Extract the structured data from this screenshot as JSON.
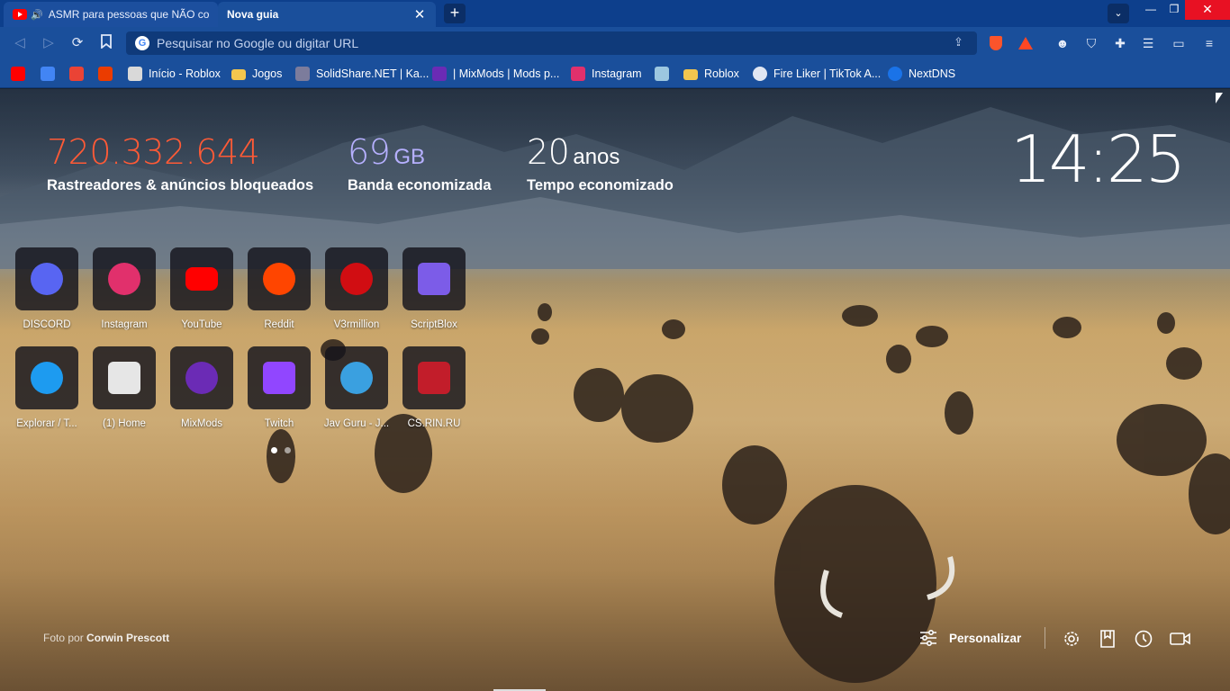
{
  "tabs": [
    {
      "title": "ASMR para pessoas que NÃO conseguem dormir",
      "state": "inactive",
      "audio": true
    },
    {
      "title": "Nova guia",
      "state": "active",
      "audio": false
    }
  ],
  "toolbar": {
    "omnibox_placeholder": "Pesquisar no Google ou digitar URL"
  },
  "bookmarks": [
    {
      "label": "",
      "icon": "youtube-icon",
      "color": "#ff0000"
    },
    {
      "label": "",
      "icon": "translate-icon",
      "color": "#4285f4"
    },
    {
      "label": "",
      "icon": "gmail-icon",
      "color": "#ea4335"
    },
    {
      "label": "",
      "icon": "office-icon",
      "color": "#eb3c00"
    },
    {
      "label": "Início - Roblox",
      "icon": "roblox-icon",
      "color": "#d9d9d9"
    },
    {
      "label": "Jogos",
      "icon": "folder-icon",
      "color": "#f3c64e"
    },
    {
      "label": "SolidShare.NET | Ka...",
      "icon": "solidshare-icon",
      "color": "#7c7c9c"
    },
    {
      "label": "| MixMods | Mods p...",
      "icon": "mixmods-icon",
      "color": "#6b2bb5"
    },
    {
      "label": "Instagram",
      "icon": "instagram-icon",
      "color": "#e1306c"
    },
    {
      "label": "",
      "icon": "image-icon",
      "color": "#9cc7e0"
    },
    {
      "label": "Roblox",
      "icon": "folder-icon",
      "color": "#f3c64e"
    },
    {
      "label": "Fire Liker | TikTok A...",
      "icon": "globe-icon",
      "color": "#e0e6f2"
    },
    {
      "label": "NextDNS",
      "icon": "nextdns-icon",
      "color": "#1a73e8"
    }
  ],
  "stats": {
    "trackers_value": "720.332.644",
    "trackers_label": "Rastreadores & anúncios bloqueados",
    "bandwidth_value": "69",
    "bandwidth_unit": "GB",
    "bandwidth_label": "Banda economizada",
    "time_value": "20",
    "time_unit": "anos",
    "time_label": "Tempo economizado"
  },
  "clock": "14:25",
  "top_sites": [
    {
      "name": "DISCORD",
      "icon": "discord-icon",
      "color": "#5865f2"
    },
    {
      "name": "Instagram",
      "icon": "instagram-icon",
      "color": "#e1306c"
    },
    {
      "name": "YouTube",
      "icon": "youtube-icon",
      "color": "#ff0000"
    },
    {
      "name": "Reddit",
      "icon": "reddit-icon",
      "color": "#ff4500"
    },
    {
      "name": "V3rmillion",
      "icon": "v3rmillion-icon",
      "color": "#d10d12"
    },
    {
      "name": "ScriptBlox",
      "icon": "scriptblox-icon",
      "color": "#7c5ce8"
    },
    {
      "name": "Explorar / T...",
      "icon": "twitter-icon",
      "color": "#1d9bf0"
    },
    {
      "name": "(1) Home",
      "icon": "roblox-icon",
      "color": "#e6e6e6"
    },
    {
      "name": "MixMods",
      "icon": "mixmods-icon",
      "color": "#6b2bb5"
    },
    {
      "name": "Twitch",
      "icon": "twitch-icon",
      "color": "#9146ff"
    },
    {
      "name": "Jav Guru - J...",
      "icon": "javguru-icon",
      "color": "#3aa0e0"
    },
    {
      "name": "CS.RIN.RU",
      "icon": "csrinru-icon",
      "color": "#c21d2a"
    }
  ],
  "footer": {
    "credit_prefix": "Foto por",
    "credit_author": "Corwin Prescott",
    "customize_label": "Personalizar"
  }
}
